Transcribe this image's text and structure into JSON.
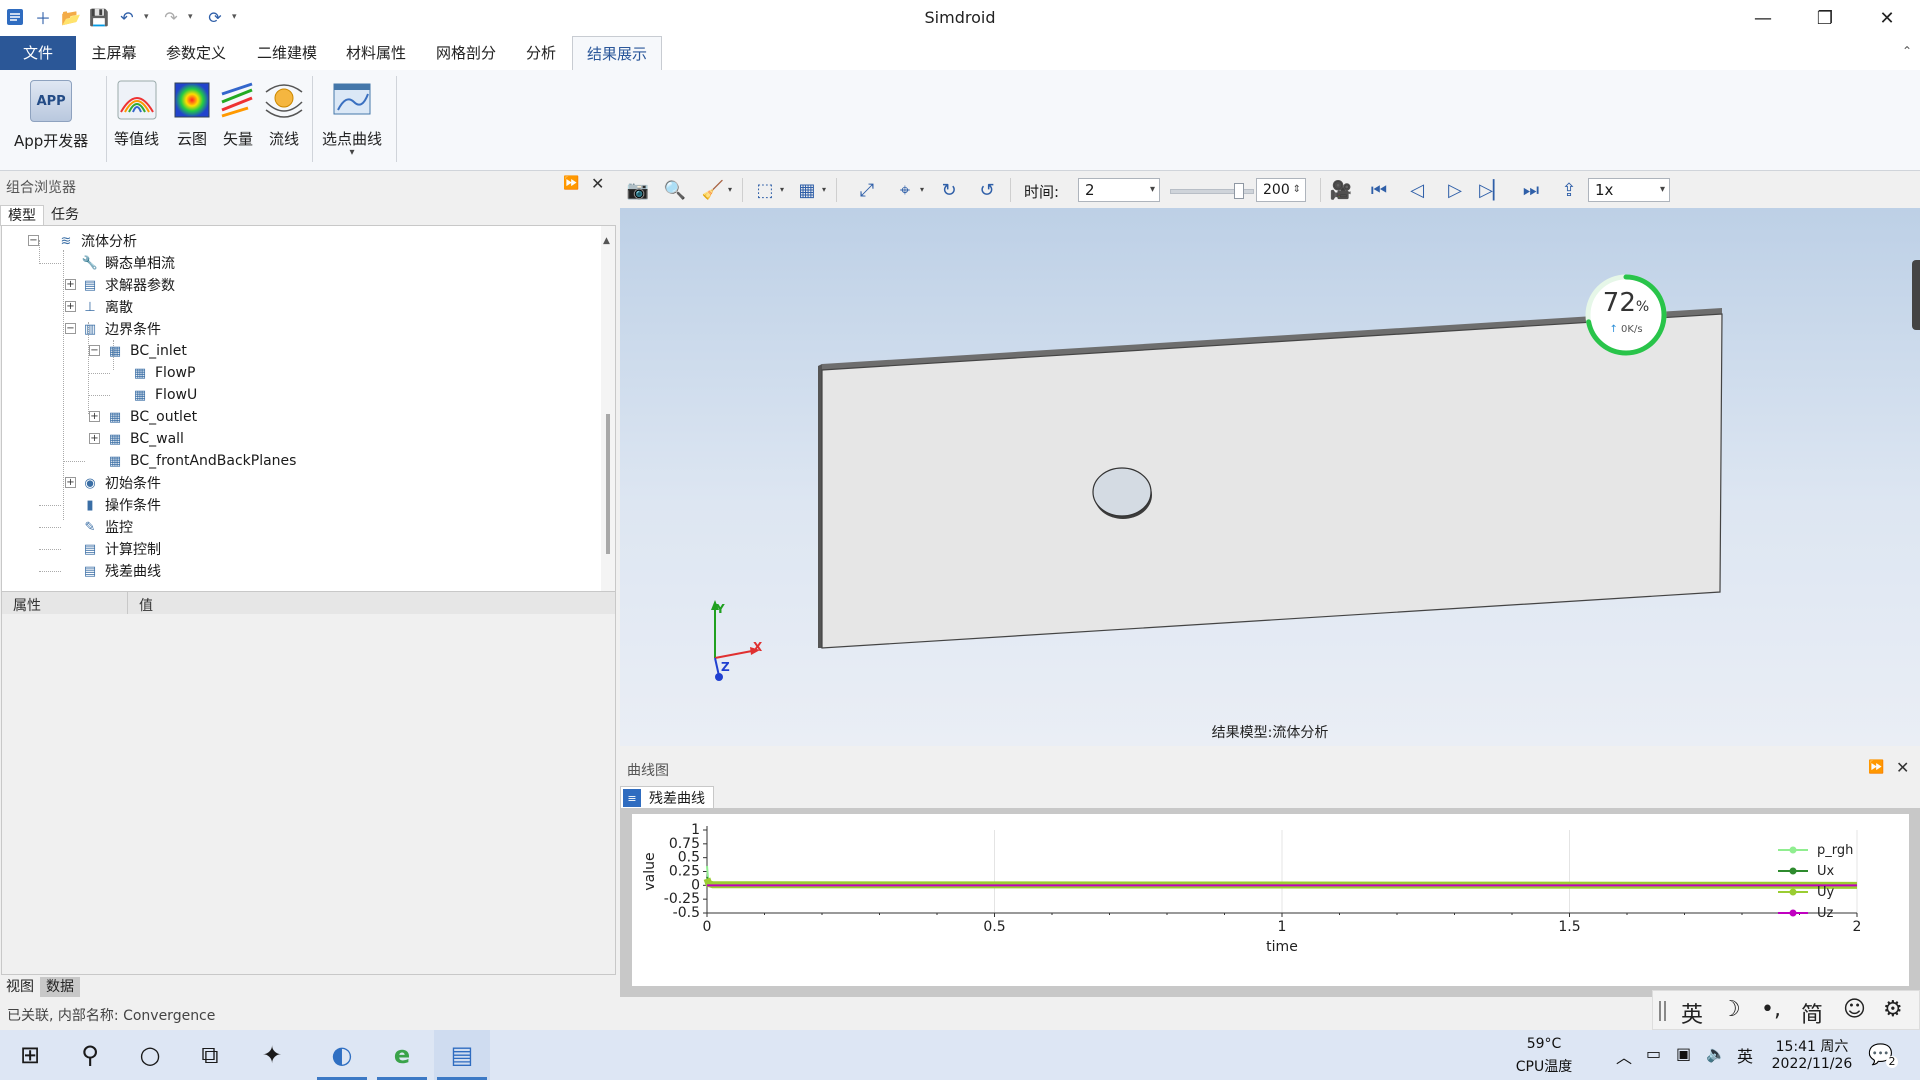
{
  "app_title": "Simdroid",
  "window_controls": {
    "minimize": "—",
    "restore": "❐",
    "close": "✕"
  },
  "quick_access": {
    "new": "＋",
    "open": "📂",
    "save": "💾",
    "undo": "↶",
    "redo": "↷",
    "refresh": "⟳",
    "customize": "▾"
  },
  "ribbon_tabs": [
    {
      "label": "文件"
    },
    {
      "label": "主屏幕"
    },
    {
      "label": "参数定义"
    },
    {
      "label": "二维建模"
    },
    {
      "label": "材料属性"
    },
    {
      "label": "网格剖分"
    },
    {
      "label": "分析"
    },
    {
      "label": "结果展示"
    }
  ],
  "ribbon_collapse": "⌃",
  "ribbon_buttons": {
    "app_dev": {
      "label": "App开发器",
      "icon_text": "APP"
    },
    "contour": {
      "label": "等值线"
    },
    "cloud": {
      "label": "云图"
    },
    "vector": {
      "label": "矢量"
    },
    "streamline": {
      "label": "流线"
    },
    "pick_curve": {
      "label": "选点曲线",
      "dropdown": "▾"
    }
  },
  "browser": {
    "title": "组合浏览器",
    "pin": "⏩",
    "close": "✕",
    "tabs": [
      {
        "label": "模型"
      },
      {
        "label": "任务"
      }
    ],
    "tree": [
      {
        "label": "流体分析",
        "expander": "−",
        "icon": "≋"
      },
      {
        "label": "瞬态单相流",
        "expander": "",
        "icon": "🔧"
      },
      {
        "label": "求解器参数",
        "expander": "+",
        "icon": "▤"
      },
      {
        "label": "离散",
        "expander": "+",
        "icon": "⊥"
      },
      {
        "label": "边界条件",
        "expander": "−",
        "icon": "▥"
      },
      {
        "label": "BC_inlet",
        "expander": "−",
        "icon": "▦"
      },
      {
        "label": "FlowP",
        "expander": "",
        "icon": "▦"
      },
      {
        "label": "FlowU",
        "expander": "",
        "icon": "▦"
      },
      {
        "label": "BC_outlet",
        "expander": "+",
        "icon": "▦"
      },
      {
        "label": "BC_wall",
        "expander": "+",
        "icon": "▦"
      },
      {
        "label": "BC_frontAndBackPlanes",
        "expander": "",
        "icon": "▦"
      },
      {
        "label": "初始条件",
        "expander": "+",
        "icon": "◉"
      },
      {
        "label": "操作条件",
        "expander": "",
        "icon": "▮"
      },
      {
        "label": "监控",
        "expander": "",
        "icon": "✎"
      },
      {
        "label": "计算控制",
        "expander": "",
        "icon": "▤"
      },
      {
        "label": "残差曲线",
        "expander": "",
        "icon": "▤"
      }
    ],
    "scroll_up": "▲",
    "scroll_down": "▼"
  },
  "properties": {
    "col_property": "属性",
    "col_value": "值"
  },
  "bottom_tabs": [
    {
      "label": "视图"
    },
    {
      "label": "数据"
    }
  ],
  "status_text": "已关联, 内部名称: Convergence",
  "viewport_toolbar": {
    "time_label": "时间:",
    "time_value": "2",
    "frame_value": "200",
    "speed_value": "1x",
    "combo_arrow": "▾",
    "spin_arrows": "⇕",
    "icons": {
      "screenshot": "📷",
      "zoom": "🔍",
      "clear": "🧹",
      "view_cube": "⬚",
      "color_grid": "▦",
      "fit": "⤢",
      "axes": "⌖",
      "rotate_cw": "↻",
      "rotate_ccw": "↺",
      "record": "🎥",
      "first": "⏮",
      "prev": "◁",
      "play": "▷",
      "next": "▷▏",
      "last": "⏭",
      "export": "⇪"
    }
  },
  "viewport": {
    "caption": "结果模型:流体分析",
    "axis": {
      "x": "X",
      "y": "Y",
      "z": "Z"
    },
    "monitor": {
      "percent_value": "72",
      "percent_unit": "%",
      "speed": "0K/s",
      "arrow": "↑",
      "percent": 72
    }
  },
  "curve_panel": {
    "title": "曲线图",
    "pin": "⏩",
    "close": "✕",
    "tab_label": "残差曲线"
  },
  "chart_data": {
    "type": "line",
    "title": "",
    "xlabel": "time",
    "ylabel": "value",
    "xlim": [
      0,
      2
    ],
    "ylim": [
      -0.5,
      1
    ],
    "xticks": [
      "0",
      "0.5",
      "1",
      "1.5",
      "2"
    ],
    "yticks": [
      "1",
      "0.75",
      "0.5",
      "0.25",
      "0",
      "-0.25",
      "-0.5"
    ],
    "grid": true,
    "legend_position": "right",
    "series": [
      {
        "name": "p_rgh",
        "color": "#90ee90",
        "x": [
          0,
          0.002,
          0.005,
          0.01,
          2
        ],
        "y": [
          0.35,
          0.1,
          0.03,
          0.01,
          0.0
        ]
      },
      {
        "name": "Ux",
        "color": "#2e8b2e",
        "x": [
          0,
          0.003,
          0.01,
          2
        ],
        "y": [
          0.15,
          0.04,
          0.01,
          0.0
        ]
      },
      {
        "name": "Uy",
        "color": "#9acd32",
        "x": [
          0,
          0.003,
          0.01,
          2
        ],
        "y": [
          0.12,
          0.03,
          0.01,
          0.0
        ]
      },
      {
        "name": "Uz",
        "color": "#c000c0",
        "x": [
          0,
          2
        ],
        "y": [
          0.0,
          0.0
        ]
      }
    ]
  },
  "ime": {
    "lang": "英",
    "moon": "☽",
    "punct": "•,",
    "simp": "简",
    "emoji": "☺",
    "settings": "⚙"
  },
  "taskbar": {
    "start": "⊞",
    "search": "⚲",
    "cortana": "○",
    "taskview": "⧉",
    "app1": "✦",
    "app2": "◐",
    "browser": "e",
    "simdroid": "▤",
    "cpu_temp": "59°C",
    "cpu_label": "CPU温度",
    "tray_chevron": "︿",
    "tray_battery": "▭",
    "tray_network": "▣",
    "tray_volume": "🔈",
    "input_lang": "英",
    "time": "15:41 周六",
    "date": "2022/11/26",
    "notif_icon": "💬",
    "notifications": "2"
  }
}
